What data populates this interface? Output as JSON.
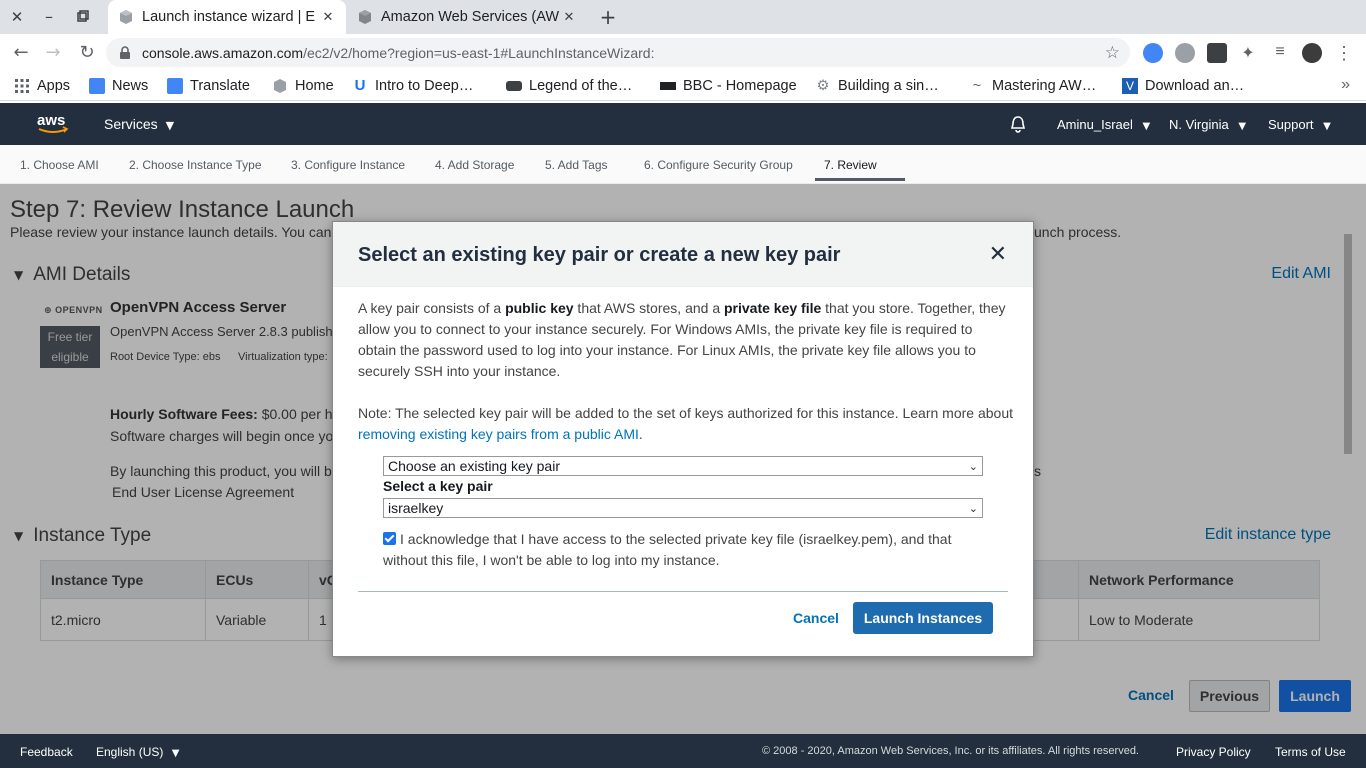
{
  "browser": {
    "tabs": [
      {
        "title": "Launch instance wizard | E",
        "active": true
      },
      {
        "title": "Amazon Web Services (AW",
        "active": false
      }
    ],
    "url_host": "console.aws.amazon.com",
    "url_path": "/ec2/v2/home?region=us-east-1#LaunchInstanceWizard:",
    "bookmarks": [
      {
        "label": "Apps",
        "icon": "apps-grid-icon"
      },
      {
        "label": "News",
        "icon": "news-icon"
      },
      {
        "label": "Translate",
        "icon": "translate-icon"
      },
      {
        "label": "Home",
        "icon": "home-icon"
      },
      {
        "label": "Intro to Deep…",
        "icon": "udacity-icon"
      },
      {
        "label": "Legend of the…",
        "icon": "car-icon"
      },
      {
        "label": "BBC - Homepage",
        "icon": "bbc-icon"
      },
      {
        "label": "Building a sin…",
        "icon": "gear-icon"
      },
      {
        "label": "Mastering AW…",
        "icon": "wave-icon"
      },
      {
        "label": "Download an…",
        "icon": "v-icon"
      }
    ]
  },
  "aws_header": {
    "services": "Services",
    "user": "Aminu_Israel",
    "region": "N. Virginia",
    "support": "Support"
  },
  "wizard_steps": [
    "1. Choose AMI",
    "2. Choose Instance Type",
    "3. Configure Instance",
    "4. Add Storage",
    "5. Add Tags",
    "6. Configure Security Group",
    "7. Review"
  ],
  "page": {
    "title": "Step 7: Review Instance Launch",
    "subtitle_start": "Please review your instance launch details. You can",
    "subtitle_end": "unch process.",
    "ami_section": "AMI Details",
    "edit_ami": "Edit AMI",
    "ami_logo": "OPENVPN",
    "free_tier_1": "Free tier",
    "free_tier_2": "eligible",
    "ami_name": "OpenVPN Access Server",
    "ami_desc": "OpenVPN Access Server 2.8.3 publish",
    "root_device": "Root Device Type: ebs",
    "virtualization": "Virtualization type:",
    "hourly_label": "Hourly Software Fees:",
    "hourly_value": "$0.00 per h",
    "software_charges": "Software charges will begin once yo",
    "by_launching": "By launching this product, you will b",
    "by_launching_tail": "s",
    "eula": "End User License Agreement",
    "instance_section": "Instance Type",
    "edit_instance": "Edit instance type",
    "table_headers": [
      "Instance Type",
      "ECUs",
      "vC",
      "Network Performance"
    ],
    "table_row": [
      "t2.micro",
      "Variable",
      "1",
      "Low to Moderate"
    ],
    "cancel": "Cancel",
    "previous": "Previous",
    "launch": "Launch"
  },
  "modal": {
    "title": "Select an existing key pair or create a new key pair",
    "p1_a": "A key pair consists of a ",
    "p1_b": "public key",
    "p1_c": " that AWS stores, and a ",
    "p1_d": "private key file",
    "p1_e": " that you store. Together, they allow you to connect to your instance securely. For Windows AMIs, the private key file is required to obtain the password used to log into your instance. For Linux AMIs, the private key file allows you to securely SSH into your instance.",
    "note_text": "Note: The selected key pair will be added to the set of keys authorized for this instance. Learn more about ",
    "note_link": "removing existing key pairs from a public AMI",
    "note_end": ".",
    "keypair_mode": "Choose an existing key pair",
    "select_label": "Select a key pair",
    "selected_keypair": "israelkey",
    "acknowledge_checked": true,
    "acknowledge": "I acknowledge that I have access to the selected private key file (israelkey.pem), and that without this file, I won't be able to log into my instance.",
    "cancel": "Cancel",
    "launch": "Launch Instances"
  },
  "footer": {
    "feedback": "Feedback",
    "language": "English (US)",
    "copyright": "© 2008 - 2020, Amazon Web Services, Inc. or its affiliates. All rights reserved.",
    "privacy": "Privacy Policy",
    "terms": "Terms of Use"
  },
  "colors": {
    "aws_nav": "#232f3e",
    "link": "#0073bb",
    "primary_button": "#1f6bb0"
  }
}
